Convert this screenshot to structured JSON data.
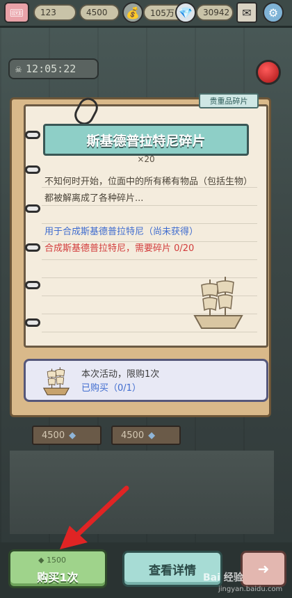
{
  "topbar": {
    "ticket_count": "123",
    "coin_count": "4500",
    "money": "105万",
    "gems": "30942"
  },
  "clock": {
    "time": "12:05:22"
  },
  "card": {
    "rarity_tag": "贵重品碎片",
    "title": "斯基德普拉特尼碎片",
    "count": "×20",
    "description": "不知何时开始，位面中的所有稀有物品（包括生物）都被解离成了各种碎片...",
    "use_line": "用于合成斯基德普拉特尼（尚未获得）",
    "need_line": "合成斯基德普拉特尼，需要碎片 0/20"
  },
  "purchase": {
    "limit_text": "本次活动，限购1次",
    "bought_text": "已购买（0/1）"
  },
  "shelf": {
    "price_left": "4500",
    "price_right": "4500"
  },
  "buttons": {
    "buy_price": "1500",
    "buy_label": "购买1次",
    "detail_label": "查看详情"
  },
  "watermark": {
    "main": "Bai 经验",
    "sub": "jingyan.baidu.com"
  },
  "colors": {
    "accent_red": "#d23c3c",
    "accent_blue": "#3f6ccf",
    "banner_teal": "#8ecfc7",
    "buy_green": "#9fd38b"
  }
}
